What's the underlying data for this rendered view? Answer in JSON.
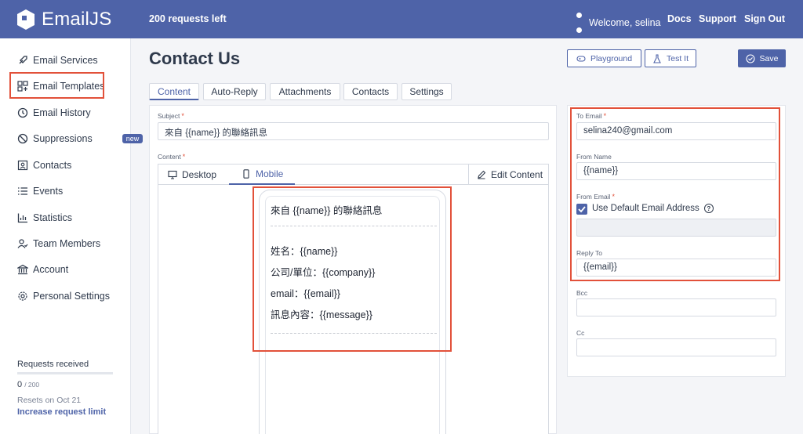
{
  "header": {
    "brand": "EmailJS",
    "requests_left": "200 requests left",
    "welcome": "Welcome,  selina",
    "links": {
      "docs": "Docs",
      "support": "Support",
      "sign_out": "Sign Out"
    }
  },
  "sidebar": {
    "items": [
      {
        "label": "Email Services",
        "icon": "rocket-icon"
      },
      {
        "label": "Email Templates",
        "icon": "template-icon"
      },
      {
        "label": "Email History",
        "icon": "history-icon"
      },
      {
        "label": "Suppressions",
        "icon": "block-icon",
        "badge": "new"
      },
      {
        "label": "Contacts",
        "icon": "contacts-icon"
      },
      {
        "label": "Events",
        "icon": "list-icon"
      },
      {
        "label": "Statistics",
        "icon": "chart-icon"
      },
      {
        "label": "Team Members",
        "icon": "team-icon"
      },
      {
        "label": "Account",
        "icon": "bank-icon"
      },
      {
        "label": "Personal Settings",
        "icon": "gear-icon"
      }
    ],
    "requests": {
      "title": "Requests received",
      "count": "0",
      "total": "/ 200",
      "progress": 0,
      "resets": "Resets on Oct 21",
      "increase_link": "Increase request limit"
    }
  },
  "page": {
    "title": "Contact Us",
    "buttons": {
      "playground": "Playground",
      "test_it": "Test It",
      "save": "Save"
    },
    "tabs": [
      "Content",
      "Auto-Reply",
      "Attachments",
      "Contacts",
      "Settings"
    ],
    "active_tab": "Content"
  },
  "content": {
    "subject_label": "Subject",
    "subject_value": "來自 {{name}} 的聯絡訊息",
    "content_label": "Content",
    "editor_tabs": {
      "desktop": "Desktop",
      "mobile": "Mobile",
      "edit": "Edit Content"
    },
    "preview": {
      "heading": "來自 {{name}} 的聯絡訊息",
      "lines": [
        "姓名：{{name}}",
        "公司/單位：{{company}}",
        "email：{{email}}",
        "訊息內容：{{message}}"
      ]
    }
  },
  "fields": {
    "to_email": {
      "label": "To Email",
      "value": "selina240@gmail.com"
    },
    "from_name": {
      "label": "From Name",
      "value": "{{name}}"
    },
    "from_email": {
      "label": "From Email",
      "checkbox_label": "Use Default Email Address",
      "checked": true,
      "value": ""
    },
    "reply_to": {
      "label": "Reply To",
      "value": "{{email}}"
    },
    "bcc": {
      "label": "Bcc",
      "value": ""
    },
    "cc": {
      "label": "Cc",
      "value": ""
    }
  },
  "colors": {
    "brand": "#4e63a8",
    "highlight": "#e2513a",
    "required": "#e2513a"
  }
}
